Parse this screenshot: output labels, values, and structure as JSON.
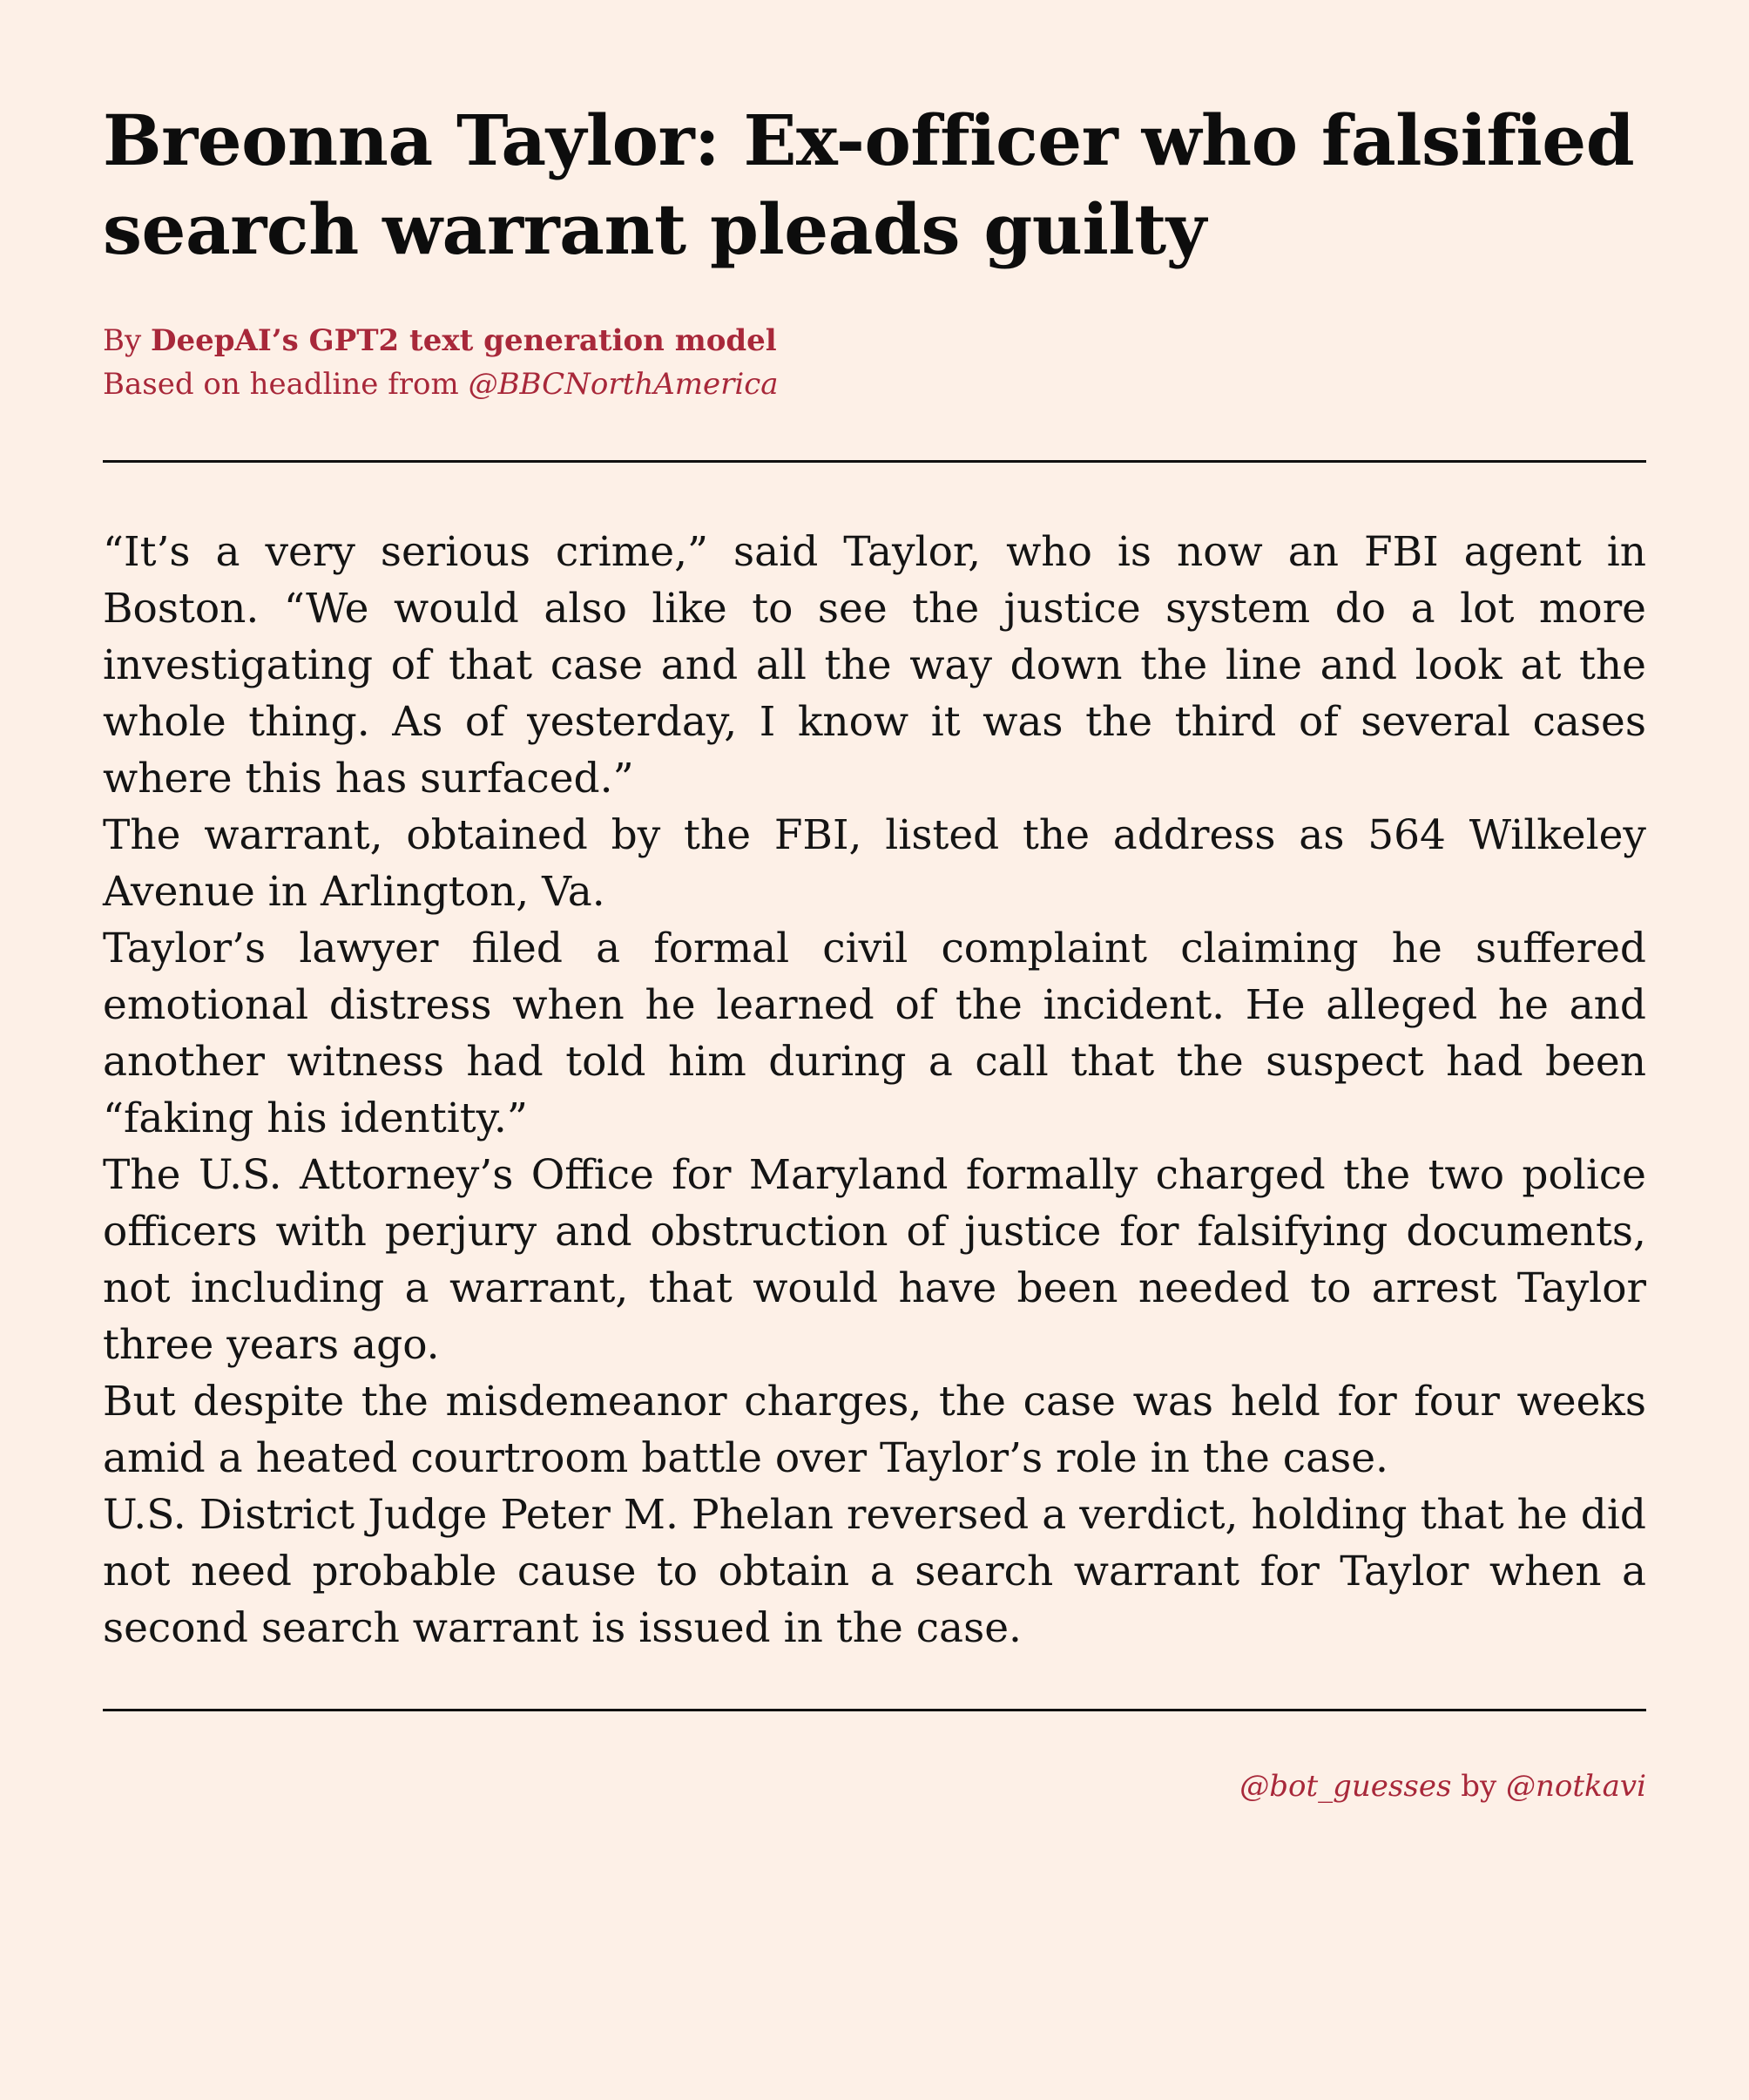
{
  "headline": "Breonna Taylor: Ex-officer who falsified search warrant pleads guilty",
  "byline": {
    "prefix": "By ",
    "model_name": "DeepAI’s GPT2 text generation model",
    "source_prefix": "Based on headline from ",
    "source_handle": "@BBCNorthAmerica"
  },
  "paragraphs": [
    "“It’s a very serious crime,” said Taylor, who is now an FBI agent in Boston. “We would also like to see the justice system do a lot more investigating of that case and all the way down the line and look at the whole thing. As of yesterday, I know it was the third of several cases where this has surfaced.”",
    "The warrant, obtained by the FBI, listed the address as 564 Wilkeley Avenue in Arlington, Va.",
    "Taylor’s lawyer filed a formal civil complaint claiming he suffered emotional distress when he learned of the incident. He alleged he and another witness had told him during a call that the suspect had been “faking his identity.”",
    "The U.S. Attorney’s Office for Maryland formally charged the two police officers with perjury and obstruction of justice for falsifying documents, not including a warrant, that would have been needed to arrest Taylor three years ago.",
    "But despite the misdemeanor charges, the case was held for four weeks amid a heated courtroom battle over Taylor’s role in the case.",
    "U.S. District Judge Peter M. Phelan reversed a verdict, holding that he did not need probable cause to obtain a search warrant for Taylor when a second search warrant is issued in the case."
  ],
  "credit": {
    "bot_handle": "@bot_guesses",
    "by": " by ",
    "author_handle": "@notkavi"
  },
  "colors": {
    "background": "#fdf0e7",
    "accent": "#a8283a",
    "text": "#111111"
  }
}
